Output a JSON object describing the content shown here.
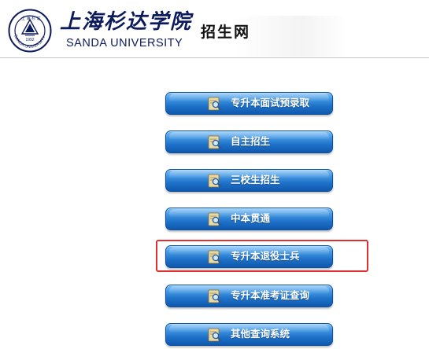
{
  "header": {
    "university_cn": "上海杉达学院",
    "university_en": "SANDA UNIVERSITY",
    "site_title": "招生网",
    "seal_year": "1992",
    "seal_text": "SANDA UNIVERSITY"
  },
  "menu": {
    "items": [
      {
        "label": "专升本面试预录取",
        "icon": "search-doc-icon"
      },
      {
        "label": "自主招生",
        "icon": "search-doc-icon"
      },
      {
        "label": "三校生招生",
        "icon": "search-doc-icon"
      },
      {
        "label": "中本贯通",
        "icon": "search-doc-icon"
      },
      {
        "label": "专升本退役士兵",
        "icon": "search-doc-icon"
      },
      {
        "label": "专升本准考证查询",
        "icon": "search-doc-icon"
      },
      {
        "label": "其他查询系统",
        "icon": "search-doc-icon"
      }
    ],
    "highlighted_index": 4
  },
  "colors": {
    "brand_navy": "#0d1a5c",
    "button_blue": "#1f72c9",
    "highlight_red": "#e03030"
  }
}
